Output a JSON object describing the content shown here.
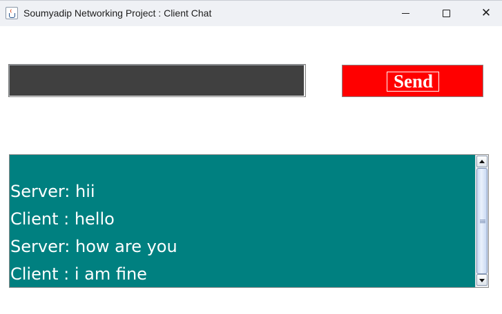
{
  "window": {
    "title": "Soumyadip Networking Project : Client Chat",
    "controls": {
      "minimize": "minimize-icon",
      "maximize": "maximize-icon",
      "close": "close-icon"
    }
  },
  "message_input": {
    "value": "",
    "background": "#404040"
  },
  "send_button": {
    "label": "Send",
    "background": "#ff0000"
  },
  "chat": {
    "background": "#008080",
    "messages": [
      "Server: hii",
      "Client : hello",
      "Server: how are you",
      "Client : i am fine"
    ]
  }
}
